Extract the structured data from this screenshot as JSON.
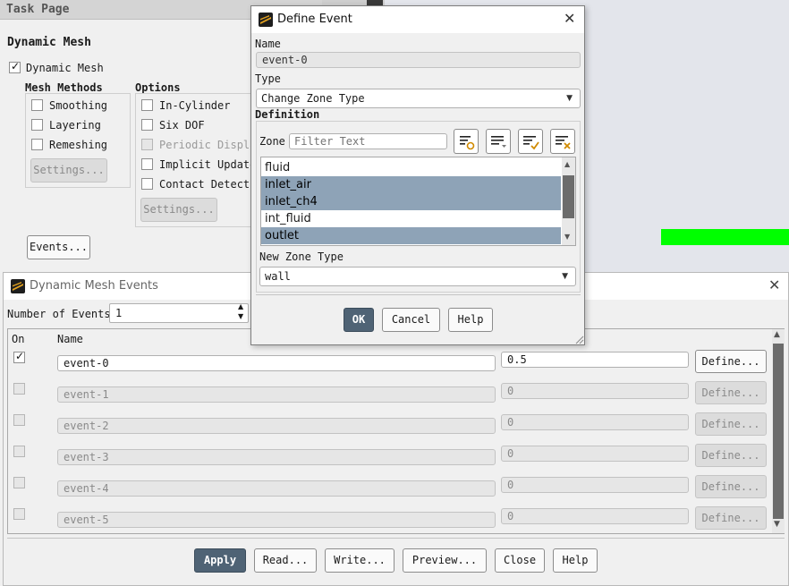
{
  "task_page": {
    "title": "Task Page",
    "section_title": "Dynamic Mesh",
    "dynamic_mesh_label": "Dynamic Mesh",
    "mesh_methods_title": "Mesh Methods",
    "mesh_methods": [
      {
        "label": "Smoothing",
        "checked": false
      },
      {
        "label": "Layering",
        "checked": false
      },
      {
        "label": "Remeshing",
        "checked": false
      }
    ],
    "mesh_settings_label": "Settings...",
    "options_title": "Options",
    "options": [
      {
        "label": "In-Cylinder",
        "checked": false,
        "disabled": false
      },
      {
        "label": "Six DOF",
        "checked": false,
        "disabled": false
      },
      {
        "label": "Periodic Displa",
        "checked": false,
        "disabled": true
      },
      {
        "label": "Implicit Update",
        "checked": false,
        "disabled": false
      },
      {
        "label": "Contact Detecti",
        "checked": false,
        "disabled": false
      }
    ],
    "options_settings_label": "Settings...",
    "events_button": "Events..."
  },
  "events_window": {
    "title": "Dynamic Mesh Events",
    "number_of_events_label": "Number of Events",
    "number_of_events": "1",
    "columns": {
      "on": "On",
      "name": "Name"
    },
    "rows": [
      {
        "on": true,
        "name": "event-0",
        "value": "0.5",
        "define": "Define...",
        "enabled": true
      },
      {
        "on": false,
        "name": "event-1",
        "value": "0",
        "define": "Define...",
        "enabled": false
      },
      {
        "on": false,
        "name": "event-2",
        "value": "0",
        "define": "Define...",
        "enabled": false
      },
      {
        "on": false,
        "name": "event-3",
        "value": "0",
        "define": "Define...",
        "enabled": false
      },
      {
        "on": false,
        "name": "event-4",
        "value": "0",
        "define": "Define...",
        "enabled": false
      },
      {
        "on": false,
        "name": "event-5",
        "value": "0",
        "define": "Define...",
        "enabled": false
      }
    ],
    "buttons": {
      "apply": "Apply",
      "read": "Read...",
      "write": "Write...",
      "preview": "Preview...",
      "close": "Close",
      "help": "Help"
    }
  },
  "define_event": {
    "title": "Define Event",
    "name_label": "Name",
    "name_value": "event-0",
    "type_label": "Type",
    "type_value": "Change Zone Type",
    "definition_label": "Definition",
    "zone_label": "Zone",
    "zone_filter_placeholder": "Filter Text",
    "zones": [
      {
        "label": "fluid",
        "selected": false
      },
      {
        "label": "inlet_air",
        "selected": true
      },
      {
        "label": "inlet_ch4",
        "selected": true
      },
      {
        "label": "int_fluid",
        "selected": false
      },
      {
        "label": "outlet",
        "selected": true
      }
    ],
    "new_zone_type_label": "New Zone Type",
    "new_zone_type_value": "wall",
    "buttons": {
      "ok": "OK",
      "cancel": "Cancel",
      "help": "Help"
    }
  },
  "colors": {
    "accent_button": "#4f6375",
    "list_selection": "#8ea3b7",
    "highlight_green": "#00ff00",
    "app_logo": "#e0a020"
  }
}
